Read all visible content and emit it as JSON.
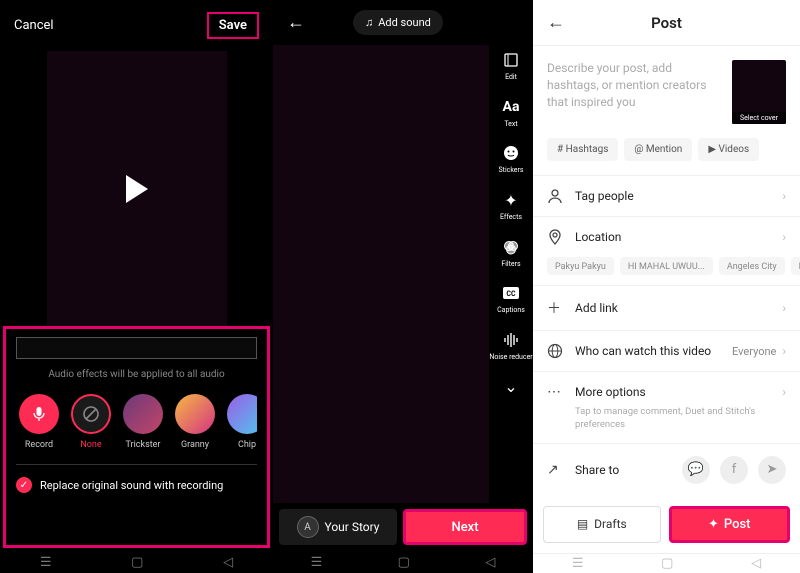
{
  "screen1": {
    "cancel": "Cancel",
    "save": "Save",
    "hint": "Audio effects will be applied to all audio",
    "effects": [
      {
        "label": "Record",
        "key": "record"
      },
      {
        "label": "None",
        "key": "none"
      },
      {
        "label": "Trickster",
        "key": "trickster"
      },
      {
        "label": "Granny",
        "key": "granny"
      },
      {
        "label": "Chip",
        "key": "chipmunk"
      }
    ],
    "replace": "Replace original sound with recording"
  },
  "screen2": {
    "add_sound": "Add sound",
    "tools": [
      {
        "label": "Edit",
        "icon": "edit"
      },
      {
        "label": "Text",
        "icon": "text"
      },
      {
        "label": "Stickers",
        "icon": "stickers"
      },
      {
        "label": "Effects",
        "icon": "effects"
      },
      {
        "label": "Filters",
        "icon": "filters"
      },
      {
        "label": "Captions",
        "icon": "captions"
      },
      {
        "label": "Noise reducer",
        "icon": "noise"
      }
    ],
    "your_story": "Your Story",
    "avatar_letter": "A",
    "next": "Next"
  },
  "screen3": {
    "title": "Post",
    "placeholder": "Describe your post, add hashtags, or mention creators that inspired you",
    "cover_label": "Select cover",
    "chips": {
      "hashtags": "# Hashtags",
      "mention": "@ Mention",
      "videos": "▶ Videos"
    },
    "tag_people": "Tag people",
    "location": "Location",
    "locations": [
      "Pakyu Pakyu",
      "HI MAHAL UWUU...",
      "Angeles City",
      "Pa"
    ],
    "add_link": "Add link",
    "privacy_label": "Who can watch this video",
    "privacy_value": "Everyone",
    "more_options": "More options",
    "more_sub": "Tap to manage comment, Duet and Stitch's preferences",
    "share_to": "Share to",
    "drafts": "Drafts",
    "post": "Post"
  }
}
